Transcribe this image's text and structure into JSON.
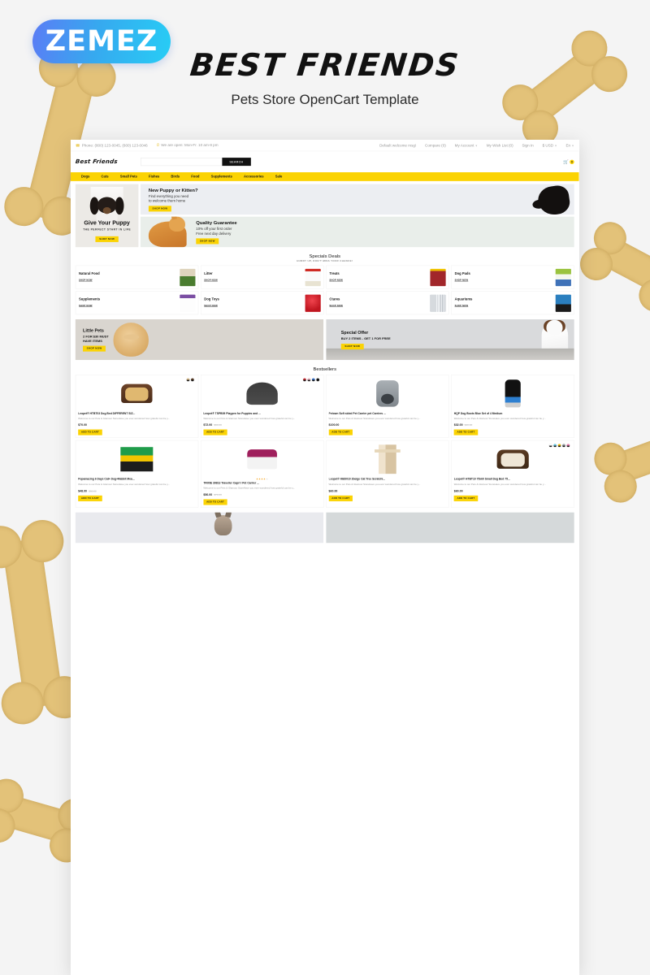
{
  "promo": {
    "logo_text": "ZEMEZ",
    "title": "BEST FRIENDS",
    "subtitle": "Pets Store OpenCart Template"
  },
  "site": {
    "topbar": {
      "phone_icon": "phone-icon",
      "phone": "Phone: (800) 123-0045, (800) 123-0046",
      "clock_icon": "clock-icon",
      "hours": "We are open: Mon-Fr. 10 am-8 pm",
      "welcome": "Default welcome msg!",
      "compare": "Compare (0)",
      "account": "My Account",
      "wishlist": "My Wish List (0)",
      "signin": "Sign In",
      "currency": "$ USD",
      "language": "En"
    },
    "header": {
      "brand": "Best Friends",
      "search_placeholder": "",
      "search_value": "",
      "search_button": "SEARCH",
      "cart_icon": "shopping-cart-icon",
      "cart_count": "0"
    },
    "nav": [
      "Dogs",
      "Cats",
      "Small Pets",
      "Fishes",
      "Birds",
      "Food",
      "Supplements",
      "Accessories",
      "Sale"
    ],
    "hero": {
      "left": {
        "title": "Give Your Puppy",
        "subtitle": "THE PERFECT START IN LIFE",
        "cta": "SHOP NOW"
      },
      "banner1": {
        "title": "New Puppy or Kitten?",
        "line1": "Find everything you need",
        "line2": "to welcome them home",
        "cta": "SHOP NOW"
      },
      "banner2": {
        "title": "Quality Guarantee",
        "line1": "10% off your first order",
        "line2": "Free next day delivery",
        "cta": "SHOP NOW"
      }
    },
    "specials": {
      "title": "Specials Deals",
      "subtitle": "HURRY UP, DON'T MISS YOUR CHANCE!",
      "shop_label": "SHOP NOW",
      "cards": [
        {
          "title": "Natural Food",
          "thumb": "th-food"
        },
        {
          "title": "Litter",
          "thumb": "th-litter"
        },
        {
          "title": "Treats",
          "thumb": "th-treats"
        },
        {
          "title": "Dog Pads",
          "thumb": "th-pads"
        },
        {
          "title": "Supplements",
          "thumb": "th-supp"
        },
        {
          "title": "Dog Toys",
          "thumb": "th-toys"
        },
        {
          "title": "Ctares",
          "thumb": "th-crates"
        },
        {
          "title": "Aquariums",
          "thumb": "th-aqua"
        }
      ]
    },
    "promos": {
      "left": {
        "title": "Little Pets",
        "line1": "2 FOR $30 MUST",
        "line2": "HAVE ITEMS",
        "cta": "SHOP NOW"
      },
      "right": {
        "title": "Special Offer",
        "line1": "BUY 2 ITEMS - GET 1 FOR FREE",
        "cta": "SHOP NOW"
      }
    },
    "bestsellers": {
      "title": "Bestsellers",
      "description": "Welcome to our Pets & Glamour StoreHave you ever wondered how grateful can be y...",
      "add_to_cart": "ADD TO CART",
      "products": [
        {
          "name": "Leopet® HTBT03 Dog Bed DIFFERENT SIZ...",
          "price": "$70.00",
          "old_price": "",
          "art": "art-bed",
          "swatches": [
            "#e0c08a",
            "#5a3a22"
          ],
          "rating": 0
        },
        {
          "name": "Leopet® TSPB09 Playpen for Puppies and ...",
          "price": "$72.00",
          "old_price": "$90.00",
          "art": "art-pen",
          "swatches": [
            "#d0202a",
            "#f2b8c6",
            "#2f6fd0",
            "#111111"
          ],
          "rating": 0
        },
        {
          "name": "Petown Soft sided Pet Carrier pet Carriers ...",
          "price": "$100.00",
          "old_price": "",
          "art": "art-carrier",
          "swatches": [],
          "rating": 0
        },
        {
          "name": "HQP Dog Boots Blue Set of 4 Medium",
          "price": "$32.00",
          "old_price": "$40.00",
          "art": "art-boot",
          "swatches": [],
          "rating": 0
        },
        {
          "name": "Popamazing 6 Days Cat+ Dog+Rabbit Mea...",
          "price": "$48.00",
          "old_price": "$60.00",
          "art": "art-feeder",
          "swatches": [],
          "rating": 0
        },
        {
          "name": "TRIXIE 39813 Traveller Capri I Pet Carrier ...",
          "price": "$56.00",
          "old_price": "$70.00",
          "art": "art-trixie",
          "swatches": [],
          "rating": 4
        },
        {
          "name": "Leopet® KBD010 2beige Cat Tree Scratchi...",
          "price": "$60.00",
          "old_price": "",
          "art": "art-tree",
          "swatches": [],
          "rating": 0
        },
        {
          "name": "Leopet® HTBT10 75x60 Small Dog Bed 75...",
          "price": "$60.00",
          "old_price": "",
          "art": "art-bed2",
          "swatches": [
            "#ffffff",
            "#66cdea",
            "#f2c500",
            "#9aa0a5",
            "#f07bb0"
          ],
          "rating": 0
        }
      ]
    }
  }
}
